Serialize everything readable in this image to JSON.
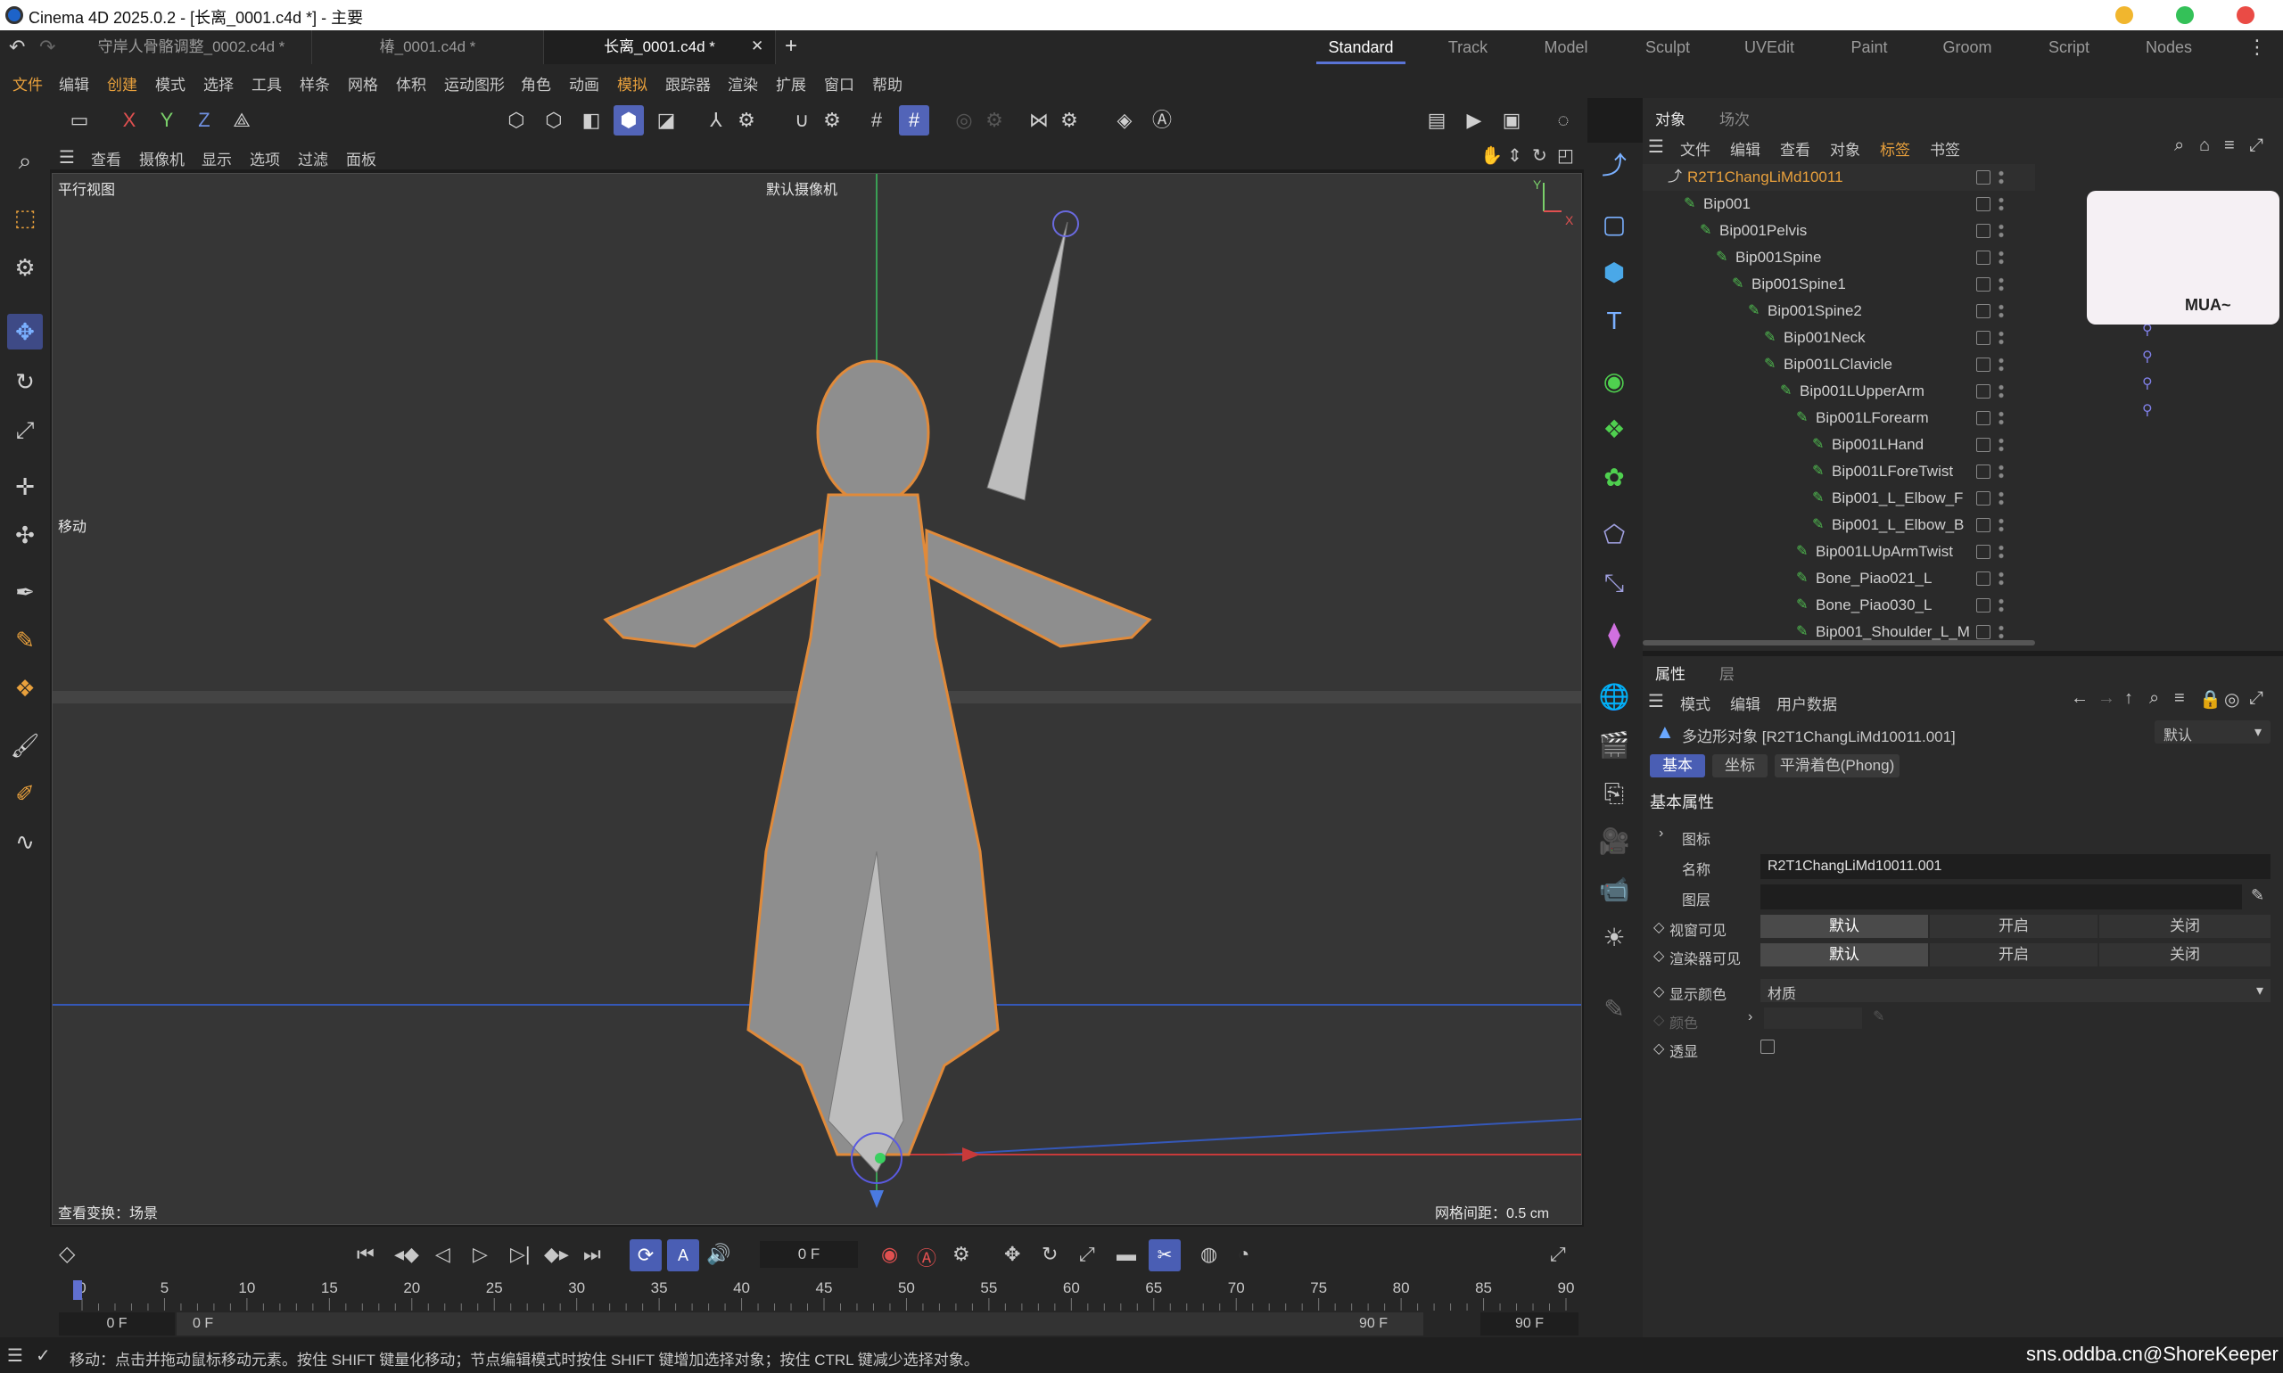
{
  "window": {
    "title": "Cinema 4D 2025.0.2 - [长离_0001.c4d *] - 主要"
  },
  "doc_tabs": [
    "守岸人骨骼调整_0002.c4d *",
    "椿_0001.c4d *",
    "长离_0001.c4d *"
  ],
  "layouts": [
    "Standard",
    "Track",
    "Model",
    "Sculpt",
    "UVEdit",
    "Paint",
    "Groom",
    "Script",
    "Nodes"
  ],
  "menu": [
    "文件",
    "编辑",
    "创建",
    "模式",
    "选择",
    "工具",
    "样条",
    "网格",
    "体积",
    "运动图形",
    "角色",
    "动画",
    "模拟",
    "跟踪器",
    "渲染",
    "扩展",
    "窗口",
    "帮助"
  ],
  "axis_buttons": [
    "X",
    "Y",
    "Z"
  ],
  "viewport_menu": [
    "查看",
    "摄像机",
    "显示",
    "选项",
    "过滤",
    "面板"
  ],
  "viewport": {
    "name": "平行视图",
    "camera": "默认摄像机",
    "tool": "移动",
    "view_transform": "查看变换：场景",
    "grid_spacing": "网格间距：0.5 cm",
    "axis_y": "Y",
    "axis_x": "X"
  },
  "obj_tabs": [
    "对象",
    "场次"
  ],
  "obj_menu": [
    "文件",
    "编辑",
    "查看",
    "对象",
    "标签",
    "书签"
  ],
  "objects": [
    "R2T1ChangLiMd10011",
    "Bip001",
    "Bip001Pelvis",
    "Bip001Spine",
    "Bip001Spine1",
    "Bip001Spine2",
    "Bip001Neck",
    "Bip001LClavicle",
    "Bip001LUpperArm",
    "Bip001LForearm",
    "Bip001LHand",
    "Bip001LForeTwist",
    "Bip001_L_Elbow_F",
    "Bip001_L_Elbow_B",
    "Bip001LUpArmTwist",
    "Bone_Piao021_L",
    "Bone_Piao030_L",
    "Bip001_Shoulder_L_M"
  ],
  "sticker_text": "MUA~",
  "attr_tabs": [
    "属性",
    "层"
  ],
  "attr_menu": [
    "模式",
    "编辑",
    "用户数据"
  ],
  "attr": {
    "object_line": "多边形对象 [R2T1ChangLiMd10011.001]",
    "preset": "默认",
    "subtabs": [
      "基本",
      "坐标",
      "平滑着色(Phong)"
    ],
    "section": "基本属性",
    "icon_label": "图标",
    "name_label": "名称",
    "name_value": "R2T1ChangLiMd10011.001",
    "layer_label": "图层",
    "vis_editor": "视窗可见",
    "vis_render": "渲染器可见",
    "vis_options": [
      "默认",
      "开启",
      "关闭"
    ],
    "display_color": "显示颜色",
    "display_color_value": "材质",
    "color_label": "颜色",
    "xray_label": "透显"
  },
  "timeline": {
    "current_frame": "0 F",
    "ticks": [
      "0",
      "5",
      "10",
      "15",
      "20",
      "25",
      "30",
      "35",
      "40",
      "45",
      "50",
      "55",
      "60",
      "65",
      "70",
      "75",
      "80",
      "85",
      "90"
    ],
    "start": "0 F",
    "start2": "0 F",
    "end": "90 F",
    "end2": "90 F"
  },
  "status": "移动：点击并拖动鼠标移动元素。按住 SHIFT 键量化移动；节点编辑模式时按住 SHIFT 键增加选择对象；按住 CTRL 键减少选择对象。",
  "watermark": "sns.oddba.cn@ShoreKeeper",
  "colors": {
    "accent": "#5a74d6",
    "orange": "#e8912c",
    "bone_green": "#4fb94f"
  }
}
